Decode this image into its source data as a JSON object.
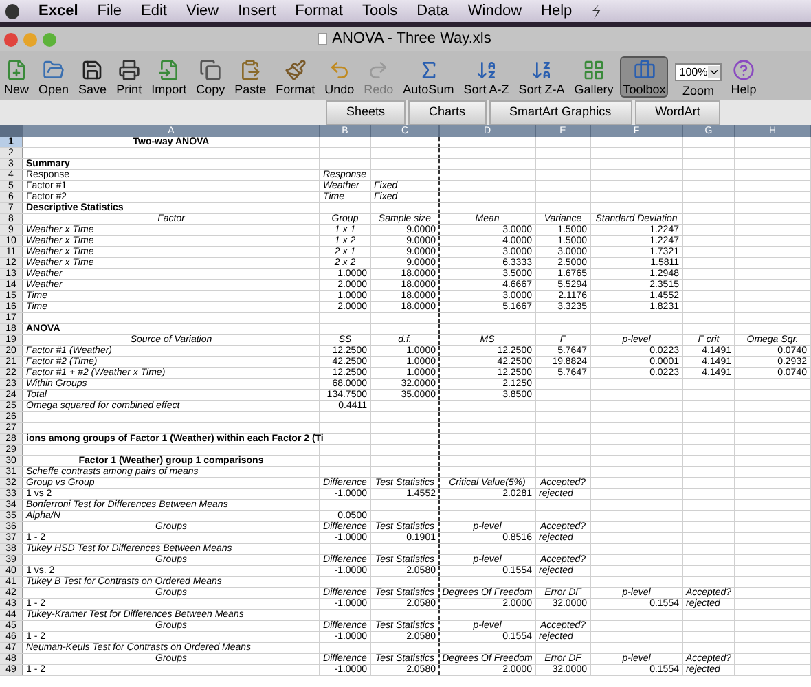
{
  "menu_bar": {
    "app": "Excel",
    "items": [
      "File",
      "Edit",
      "View",
      "Insert",
      "Format",
      "Tools",
      "Data",
      "Window",
      "Help"
    ]
  },
  "window": {
    "title": "ANOVA - Three Way.xls"
  },
  "toolbar": [
    {
      "kind": "button",
      "label": "New",
      "disabled": false,
      "selected": false
    },
    {
      "kind": "button",
      "label": "Open",
      "disabled": false,
      "selected": false
    },
    {
      "kind": "button",
      "label": "Save",
      "disabled": false,
      "selected": false
    },
    {
      "kind": "button",
      "label": "Print",
      "disabled": false,
      "selected": false
    },
    {
      "kind": "button",
      "label": "Import",
      "disabled": false,
      "selected": false
    },
    {
      "kind": "button",
      "label": "Copy",
      "disabled": false,
      "selected": false
    },
    {
      "kind": "button",
      "label": "Paste",
      "disabled": false,
      "selected": false
    },
    {
      "kind": "button",
      "label": "Format",
      "disabled": false,
      "selected": false
    },
    {
      "kind": "button",
      "label": "Undo",
      "disabled": false,
      "selected": false
    },
    {
      "kind": "button",
      "label": "Redo",
      "disabled": true,
      "selected": false
    },
    {
      "kind": "button",
      "label": "AutoSum",
      "disabled": false,
      "selected": false
    },
    {
      "kind": "button",
      "label": "Sort A-Z",
      "disabled": false,
      "selected": false
    },
    {
      "kind": "button",
      "label": "Sort Z-A",
      "disabled": false,
      "selected": false
    },
    {
      "kind": "button",
      "label": "Gallery",
      "disabled": false,
      "selected": false
    },
    {
      "kind": "button",
      "label": "Toolbox",
      "disabled": false,
      "selected": true
    },
    {
      "kind": "field",
      "label": "Zoom",
      "value": "100%"
    },
    {
      "kind": "button",
      "label": "Help",
      "disabled": false,
      "selected": false
    }
  ],
  "ribbon_tabs": [
    {
      "label": "Sheets",
      "selected": false
    },
    {
      "label": "Charts",
      "selected": false
    },
    {
      "label": "SmartArt Graphics",
      "selected": false
    },
    {
      "label": "WordArt",
      "selected": false
    }
  ],
  "columns": [
    "A",
    "B",
    "C",
    "D",
    "E",
    "F",
    "G",
    "H"
  ],
  "rows": [
    {
      "number": "1",
      "selected": true,
      "kind": "title",
      "cells": [
        "Two-way ANOVA"
      ]
    },
    {
      "number": "2",
      "selected": false
    },
    {
      "number": "3",
      "selected": false,
      "kind": "heading",
      "cells": [
        "Summary"
      ]
    },
    {
      "number": "4",
      "selected": false,
      "kind": "summary",
      "cells": [
        "Response",
        "Response"
      ]
    },
    {
      "number": "5",
      "selected": false,
      "kind": "summary",
      "cells": [
        "Factor #1",
        "Weather",
        "Fixed"
      ]
    },
    {
      "number": "6",
      "selected": false,
      "kind": "summary",
      "cells": [
        "Factor #2",
        "Time",
        "Fixed"
      ]
    },
    {
      "number": "7",
      "selected": false,
      "kind": "heading",
      "cells": [
        "Descriptive Statistics"
      ]
    },
    {
      "number": "8",
      "selected": false,
      "kind": "header",
      "cells": [
        "Factor",
        "Group",
        "Sample size",
        "Mean",
        "Variance",
        "Standard Deviation"
      ]
    },
    {
      "number": "9",
      "selected": false,
      "kind": "group",
      "cells": [
        "Weather x Time",
        "1 x 1",
        "9.0000",
        "3.0000",
        "1.5000",
        "1.2247"
      ]
    },
    {
      "number": "10",
      "selected": false,
      "kind": "group",
      "cells": [
        "Weather x Time",
        "1 x 2",
        "9.0000",
        "4.0000",
        "1.5000",
        "1.2247"
      ]
    },
    {
      "number": "11",
      "selected": false,
      "kind": "group",
      "cells": [
        "Weather x Time",
        "2 x 1",
        "9.0000",
        "3.0000",
        "3.0000",
        "1.7321"
      ]
    },
    {
      "number": "12",
      "selected": false,
      "kind": "group",
      "cells": [
        "Weather x Time",
        "2 x 2",
        "9.0000",
        "6.3333",
        "2.5000",
        "1.5811"
      ]
    },
    {
      "number": "13",
      "selected": false,
      "kind": "stat",
      "cells": [
        "Weather",
        "1.0000",
        "18.0000",
        "3.5000",
        "1.6765",
        "1.2948"
      ]
    },
    {
      "number": "14",
      "selected": false,
      "kind": "stat",
      "cells": [
        "Weather",
        "2.0000",
        "18.0000",
        "4.6667",
        "5.5294",
        "2.3515"
      ]
    },
    {
      "number": "15",
      "selected": false,
      "kind": "stat",
      "cells": [
        "Time",
        "1.0000",
        "18.0000",
        "3.0000",
        "2.1176",
        "1.4552"
      ]
    },
    {
      "number": "16",
      "selected": false,
      "kind": "stat",
      "cells": [
        "Time",
        "2.0000",
        "18.0000",
        "5.1667",
        "3.3235",
        "1.8231"
      ]
    },
    {
      "number": "17",
      "selected": false
    },
    {
      "number": "18",
      "selected": false,
      "kind": "heading",
      "cells": [
        "ANOVA"
      ]
    },
    {
      "number": "19",
      "selected": false,
      "kind": "header",
      "cells": [
        "Source of Variation",
        "SS",
        "d.f.",
        "MS",
        "F",
        "p-level",
        "F crit",
        "Omega Sqr."
      ]
    },
    {
      "number": "20",
      "selected": false,
      "kind": "stat",
      "cells": [
        "Factor #1 (Weather)",
        "12.2500",
        "1.0000",
        "12.2500",
        "5.7647",
        "0.0223",
        "4.1491",
        "0.0740"
      ]
    },
    {
      "number": "21",
      "selected": false,
      "kind": "stat",
      "cells": [
        "Factor #2 (Time)",
        "42.2500",
        "1.0000",
        "42.2500",
        "19.8824",
        "0.0001",
        "4.1491",
        "0.2932"
      ]
    },
    {
      "number": "22",
      "selected": false,
      "kind": "stat",
      "cells": [
        "Factor #1 + #2 (Weather x Time)",
        "12.2500",
        "1.0000",
        "12.2500",
        "5.7647",
        "0.0223",
        "4.1491",
        "0.0740"
      ]
    },
    {
      "number": "23",
      "selected": false,
      "kind": "stat",
      "cells": [
        "Within Groups",
        "68.0000",
        "32.0000",
        "2.1250"
      ]
    },
    {
      "number": "24",
      "selected": false,
      "kind": "stat",
      "cells": [
        "Total",
        "134.7500",
        "35.0000",
        "3.8500"
      ]
    },
    {
      "number": "25",
      "selected": false,
      "kind": "stat",
      "cells": [
        "Omega squared for combined effect",
        "0.4411"
      ]
    },
    {
      "number": "26",
      "selected": false
    },
    {
      "number": "27",
      "selected": false
    },
    {
      "number": "28",
      "selected": false,
      "kind": "heading",
      "cells": [
        "ions among groups of Factor 1 (Weather) within each Factor 2 (Ti"
      ]
    },
    {
      "number": "29",
      "selected": false
    },
    {
      "number": "30",
      "selected": false,
      "kind": "title",
      "cells": [
        "Factor 1 (Weather) group 1 comparisons"
      ]
    },
    {
      "number": "31",
      "selected": false,
      "kind": "note",
      "cells": [
        "Scheffe contrasts among pairs of means"
      ]
    },
    {
      "number": "32",
      "selected": false,
      "kind": "header_left",
      "cells": [
        "Group vs Group",
        "Difference",
        "Test Statistics",
        "Critical Value(5%)",
        "Accepted?"
      ]
    },
    {
      "number": "33",
      "selected": false,
      "kind": "result",
      "cells": [
        "1 vs  2",
        "-1.0000",
        "1.4552",
        "2.0281",
        "rejected"
      ]
    },
    {
      "number": "34",
      "selected": false,
      "kind": "note",
      "cells": [
        "Bonferroni Test for Differences Between Means"
      ]
    },
    {
      "number": "35",
      "selected": false,
      "kind": "stat",
      "cells": [
        "Alpha/N",
        "0.0500"
      ]
    },
    {
      "number": "36",
      "selected": false,
      "kind": "header",
      "cells": [
        "Groups",
        "Difference",
        "Test Statistics",
        "p-level",
        "Accepted?"
      ]
    },
    {
      "number": "37",
      "selected": false,
      "kind": "result",
      "cells": [
        "1 - 2",
        "-1.0000",
        "0.1901",
        "0.8516",
        "rejected"
      ]
    },
    {
      "number": "38",
      "selected": false,
      "kind": "note",
      "cells": [
        "Tukey HSD Test for Differences Between Means"
      ]
    },
    {
      "number": "39",
      "selected": false,
      "kind": "header",
      "cells": [
        "Groups",
        "Difference",
        "Test Statistics",
        "p-level",
        "Accepted?"
      ]
    },
    {
      "number": "40",
      "selected": false,
      "kind": "result",
      "cells": [
        "1 vs. 2",
        "-1.0000",
        "2.0580",
        "0.1554",
        "rejected"
      ]
    },
    {
      "number": "41",
      "selected": false,
      "kind": "note",
      "cells": [
        "Tukey B Test for Contrasts on Ordered Means"
      ]
    },
    {
      "number": "42",
      "selected": false,
      "kind": "header",
      "cells": [
        "Groups",
        "Difference",
        "Test Statistics",
        "Degrees Of Freedom",
        "Error DF",
        "p-level",
        "Accepted?"
      ]
    },
    {
      "number": "43",
      "selected": false,
      "kind": "result",
      "cells": [
        "1 - 2",
        "-1.0000",
        "2.0580",
        "2.0000",
        "32.0000",
        "0.1554",
        "rejected"
      ]
    },
    {
      "number": "44",
      "selected": false,
      "kind": "note",
      "cells": [
        "Tukey-Kramer Test for Differences Between Means"
      ]
    },
    {
      "number": "45",
      "selected": false,
      "kind": "header",
      "cells": [
        "Groups",
        "Difference",
        "Test Statistics",
        "p-level",
        "Accepted?"
      ]
    },
    {
      "number": "46",
      "selected": false,
      "kind": "result",
      "cells": [
        "1 - 2",
        "-1.0000",
        "2.0580",
        "0.1554",
        "rejected"
      ]
    },
    {
      "number": "47",
      "selected": false,
      "kind": "note",
      "cells": [
        "Neuman-Keuls Test for Contrasts on Ordered Means"
      ]
    },
    {
      "number": "48",
      "selected": false,
      "kind": "header",
      "cells": [
        "Groups",
        "Difference",
        "Test Statistics",
        "Degrees Of Freedom",
        "Error DF",
        "p-level",
        "Accepted?"
      ]
    },
    {
      "number": "49",
      "selected": false,
      "kind": "result",
      "cells": [
        "1 - 2",
        "-1.0000",
        "2.0580",
        "2.0000",
        "32.0000",
        "0.1554",
        "rejected"
      ]
    }
  ]
}
